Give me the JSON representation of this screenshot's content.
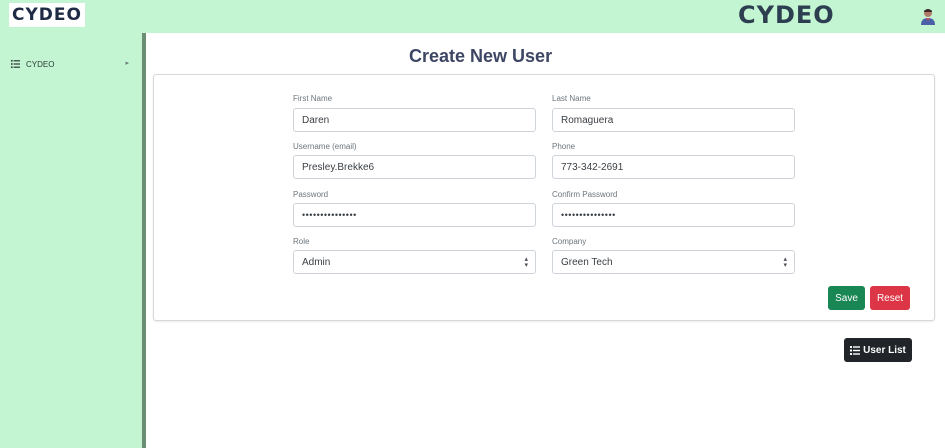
{
  "header": {
    "logo_text": "CYDEO",
    "brand_text": "CYDEO",
    "avatar_icon": "user-avatar-icon"
  },
  "sidebar": {
    "items": [
      {
        "label": "CYDEO",
        "icon": "list-icon"
      }
    ]
  },
  "page": {
    "title": "Create New User"
  },
  "form": {
    "first_name": {
      "label": "First Name",
      "value": "Daren"
    },
    "last_name": {
      "label": "Last Name",
      "value": "Romaguera"
    },
    "username": {
      "label": "Username (email)",
      "value": "Presley.Brekke6"
    },
    "phone": {
      "label": "Phone",
      "value": "773-342-2691"
    },
    "password": {
      "label": "Password",
      "value": "•••••••••••••••"
    },
    "confirm_password": {
      "label": "Confirm Password",
      "value": "•••••••••••••••"
    },
    "role": {
      "label": "Role",
      "value": "Admin"
    },
    "company": {
      "label": "Company",
      "value": "Green Tech"
    }
  },
  "buttons": {
    "save": "Save",
    "reset": "Reset",
    "user_list": "User List"
  },
  "colors": {
    "header_bg": "#c3f5d2",
    "save": "#198754",
    "reset": "#dc3545",
    "user_list": "#212529"
  }
}
